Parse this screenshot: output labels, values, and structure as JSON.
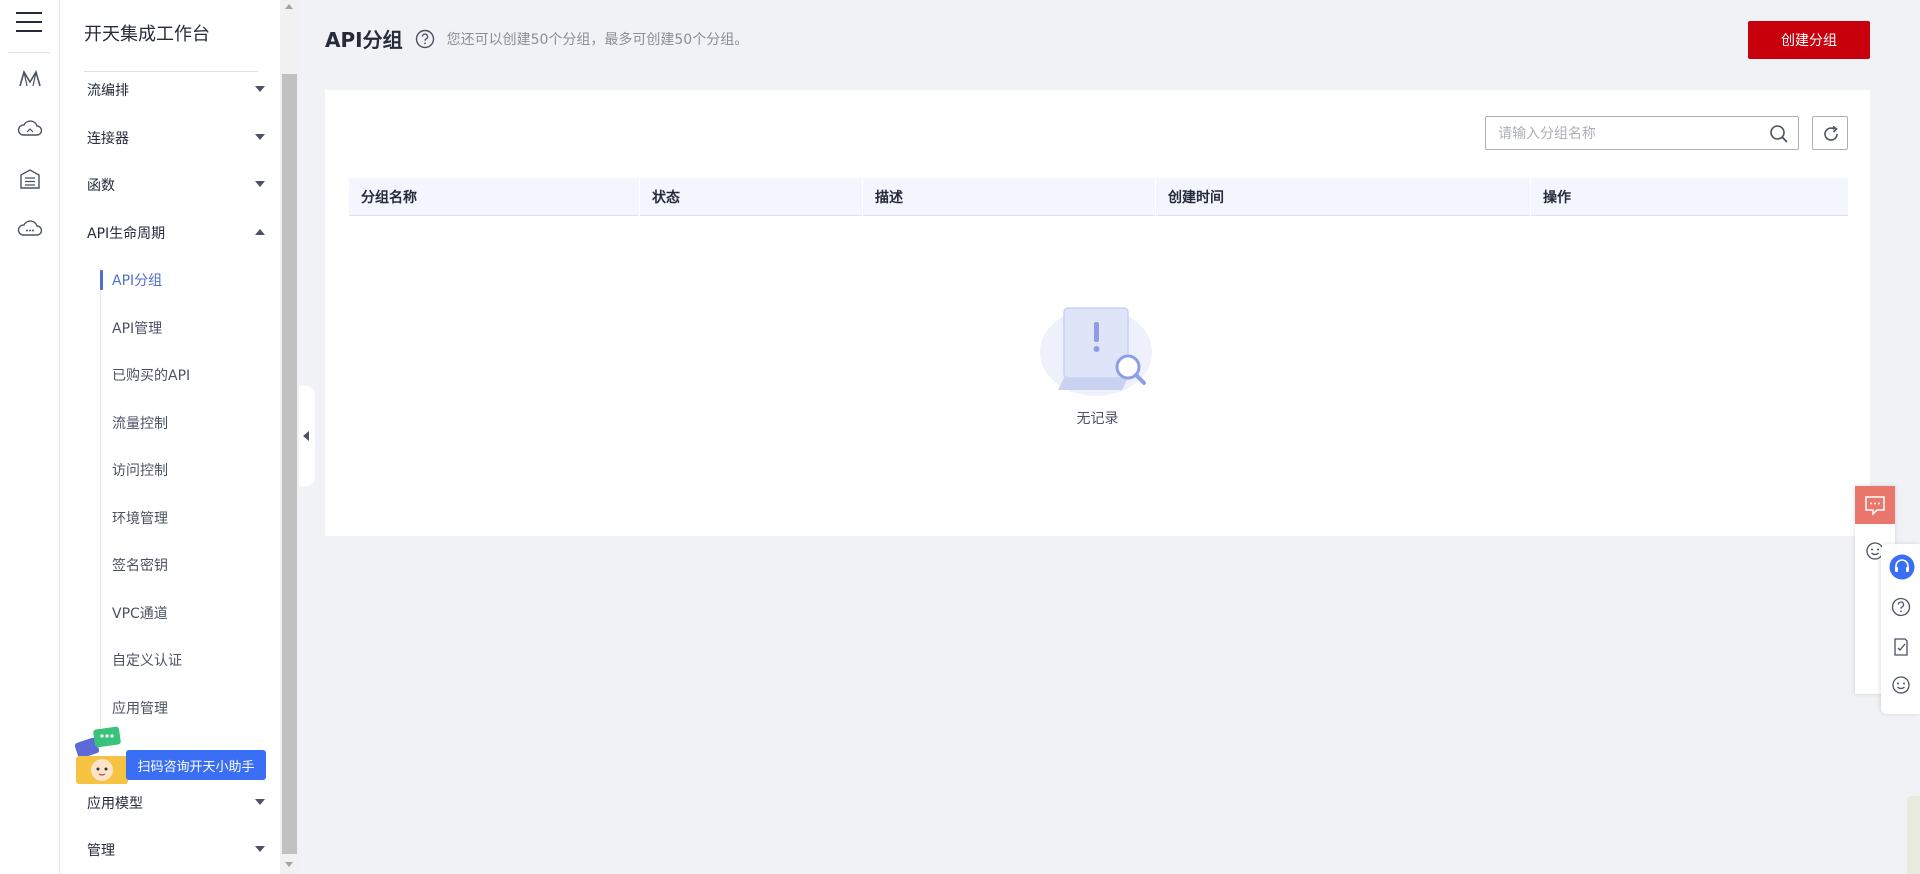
{
  "rail": {
    "icons": [
      "menu-icon",
      "logo-m-icon",
      "cloud-icon",
      "building-icon",
      "cloud-chat-icon"
    ]
  },
  "sidebar": {
    "workspace_title": "开天集成工作台",
    "items": [
      {
        "label": "流编排"
      },
      {
        "label": "连接器"
      },
      {
        "label": "函数"
      },
      {
        "label": "API生命周期"
      },
      {
        "label": "应用模型"
      },
      {
        "label": "管理"
      }
    ],
    "subitems": [
      {
        "label": "API分组"
      },
      {
        "label": "API管理"
      },
      {
        "label": "已购买的API"
      },
      {
        "label": "流量控制"
      },
      {
        "label": "访问控制"
      },
      {
        "label": "环境管理"
      },
      {
        "label": "签名密钥"
      },
      {
        "label": "VPC通道"
      },
      {
        "label": "自定义认证"
      },
      {
        "label": "应用管理"
      }
    ],
    "helper_button": "扫码咨询开天小助手"
  },
  "main": {
    "title": "API分组",
    "hint": "您还可以创建50个分组，最多可创建50个分组。",
    "create_button": "创建分组",
    "search": {
      "placeholder": "请输入分组名称",
      "value": ""
    },
    "columns": [
      "分组名称",
      "状态",
      "描述",
      "创建时间",
      "操作"
    ],
    "rows": [],
    "empty_text": "无记录"
  },
  "colors": {
    "primary": "#c7000b",
    "accent": "#526ecc",
    "helper": "#3a6ef5",
    "chat": "#e9776b"
  }
}
